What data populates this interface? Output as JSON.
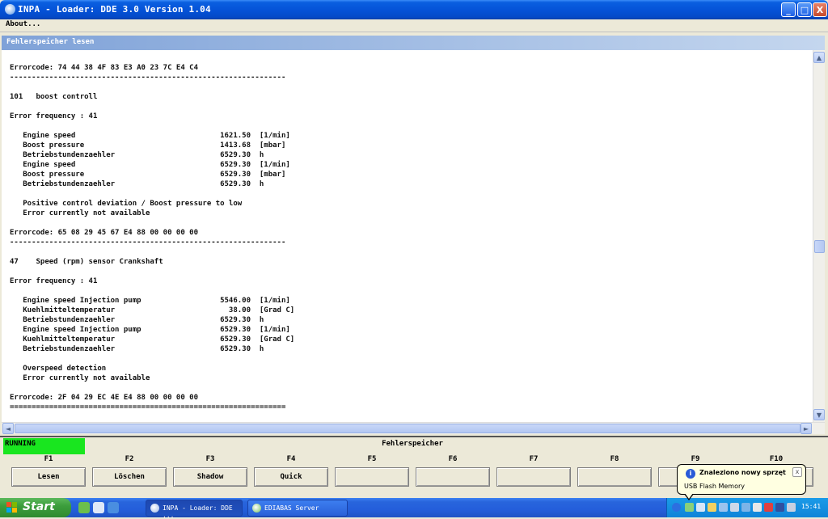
{
  "window": {
    "title": "INPA - Loader:  DDE 3.0 Version 1.04",
    "minimize": "_",
    "maximize": "□",
    "close": "X"
  },
  "menu": {
    "about": "About..."
  },
  "panel": {
    "title": "Fehlerspeicher lesen"
  },
  "report_lines": [
    "Errorcode: 74 44 38 4F 83 E3 A0 23 7C E4 C4",
    "---------------------------------------------------------------",
    "",
    "101   boost controll",
    "",
    "Error frequency : 41",
    "",
    "   Engine speed                                 1621.50  [1/min]",
    "   Boost pressure                               1413.68  [mbar]",
    "   Betriebstundenzaehler                        6529.30  h",
    "   Engine speed                                 6529.30  [1/min]",
    "   Boost pressure                               6529.30  [mbar]",
    "   Betriebstundenzaehler                        6529.30  h",
    "",
    "   Positive control deviation / Boost pressure to low",
    "   Error currently not available",
    "",
    "Errorcode: 65 08 29 45 67 E4 88 00 00 00 00",
    "---------------------------------------------------------------",
    "",
    "47    Speed (rpm) sensor Crankshaft",
    "",
    "Error frequency : 41",
    "",
    "   Engine speed Injection pump                  5546.00  [1/min]",
    "   Kuehlmitteltemperatur                          38.00  [Grad C]",
    "   Betriebstundenzaehler                        6529.30  h",
    "   Engine speed Injection pump                  6529.30  [1/min]",
    "   Kuehlmitteltemperatur                        6529.30  [Grad C]",
    "   Betriebstundenzaehler                        6529.30  h",
    "",
    "   Overspeed detection",
    "   Error currently not available",
    "",
    "Errorcode: 2F 04 29 EC 4E E4 88 00 00 00 00",
    "==============================================================="
  ],
  "scroll": {
    "up": "▲",
    "down": "▼",
    "left": "◄",
    "right": "►"
  },
  "status": {
    "state": "RUNNING",
    "title": "Fehlerspeicher"
  },
  "function_keys": [
    {
      "key": "F1",
      "label": "Lesen"
    },
    {
      "key": "F2",
      "label": "Löschen"
    },
    {
      "key": "F3",
      "label": "Shadow"
    },
    {
      "key": "F4",
      "label": "Quick"
    },
    {
      "key": "F5",
      "label": ""
    },
    {
      "key": "F6",
      "label": ""
    },
    {
      "key": "F7",
      "label": ""
    },
    {
      "key": "F8",
      "label": ""
    },
    {
      "key": "F9",
      "label": ""
    },
    {
      "key": "F10",
      "label": ""
    }
  ],
  "taskbar": {
    "start": "Start",
    "tasks": [
      "INPA - Loader:  DDE ...",
      "EDIABAS Server"
    ],
    "clock": "15:41"
  },
  "balloon": {
    "title": "Znaleziono nowy sprzęt",
    "text": "USB Flash Memory",
    "close": "x",
    "info": "i"
  },
  "colors": {
    "titlebar": "#0553d8",
    "running": "#19e61f",
    "taskbar": "#245edb",
    "start": "#3c9e3c"
  }
}
